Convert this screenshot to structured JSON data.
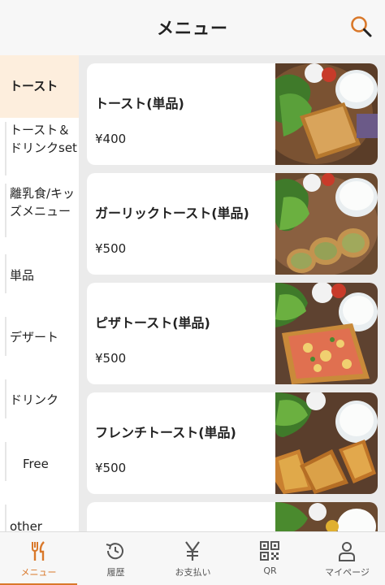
{
  "header": {
    "title": "メニュー"
  },
  "sidebar": {
    "items": [
      {
        "label": "トースト",
        "active": true
      },
      {
        "label": "トースト＆ドリンクset",
        "active": false
      },
      {
        "label": "離乳食/キッズメニュー",
        "active": false
      },
      {
        "label": "単品",
        "active": false
      },
      {
        "label": "デザート",
        "active": false
      },
      {
        "label": "ドリンク",
        "active": false
      },
      {
        "label": "Free",
        "active": false
      },
      {
        "label": "other",
        "active": false
      }
    ]
  },
  "menu": {
    "items": [
      {
        "name": "トースト(単品)",
        "price": "¥400"
      },
      {
        "name": "ガーリックトースト(単品)",
        "price": "¥500"
      },
      {
        "name": "ピザトースト(単品)",
        "price": "¥500"
      },
      {
        "name": "フレンチトースト(単品)",
        "price": "¥500"
      }
    ]
  },
  "bottom_nav": {
    "items": [
      {
        "label": "メニュー",
        "icon": "fork-knife-icon",
        "active": true
      },
      {
        "label": "履歴",
        "icon": "history-icon",
        "active": false
      },
      {
        "label": "お支払い",
        "icon": "yen-icon",
        "active": false
      },
      {
        "label": "QR",
        "icon": "qr-code-icon",
        "active": false
      },
      {
        "label": "マイページ",
        "icon": "user-icon",
        "active": false
      }
    ]
  },
  "colors": {
    "accent": "#d9782a",
    "active_bg": "#fdeedd",
    "background": "#ebebeb"
  }
}
